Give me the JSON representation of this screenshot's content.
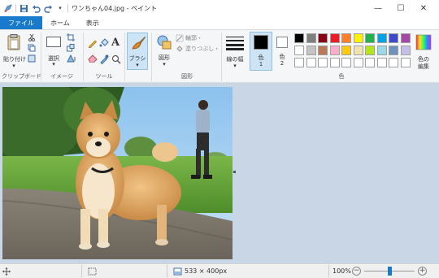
{
  "window": {
    "title": "ワンちゃん04.jpg - ペイント",
    "minimize_icon": "—",
    "maximize_icon": "☐",
    "close_icon": "✕"
  },
  "tabs": [
    {
      "label": "ファイル"
    },
    {
      "label": "ホーム"
    },
    {
      "label": "表示"
    }
  ],
  "ribbon": {
    "clipboard": {
      "paste_label": "貼り付け",
      "group_label": "クリップボード"
    },
    "image": {
      "select_label": "選択",
      "group_label": "イメージ"
    },
    "tools": {
      "group_label": "ツール",
      "text_tool": "A"
    },
    "brushes": {
      "label": "ブラシ"
    },
    "shapes": {
      "shapes_label": "図形",
      "outline_label": "輪郭・",
      "fill_label": "塗りつぶし・",
      "group_label": "図形"
    },
    "line_width_label": "線の幅",
    "color1": {
      "label": "色",
      "number": "1"
    },
    "color2": {
      "label": "色",
      "number": "2"
    },
    "palette_label": "色",
    "edit_colors": {
      "line1": "色の",
      "line2": "編集"
    },
    "colors": {
      "color1": "#000000",
      "color2": "#ffffff",
      "row1": [
        "#000000",
        "#7f7f7f",
        "#880015",
        "#ed1c24",
        "#ff7f27",
        "#fff200",
        "#22b14c",
        "#00a2e8",
        "#3f48cc",
        "#a349a4"
      ],
      "row2": [
        "#ffffff",
        "#c3c3c3",
        "#b97a57",
        "#ffaec9",
        "#ffc90e",
        "#efe4b0",
        "#b5e61d",
        "#99d9ea",
        "#7092be",
        "#c8bfe7"
      ],
      "row3": [
        "#ffffff",
        "#ffffff",
        "#ffffff",
        "#ffffff",
        "#ffffff",
        "#ffffff",
        "#ffffff",
        "#ffffff",
        "#ffffff",
        "#ffffff"
      ]
    }
  },
  "status": {
    "dimensions": "533 × 400px",
    "zoom": "100%",
    "zoom_slider_level": 0.5
  }
}
